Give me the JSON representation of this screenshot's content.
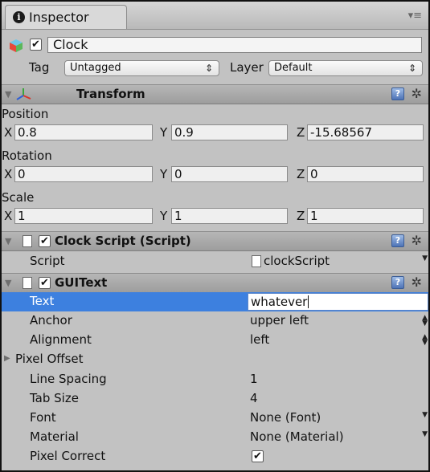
{
  "window": {
    "tab_label": "Inspector",
    "tab_icon": "info-icon",
    "menu_icon": "tab-menu-icon"
  },
  "game_object": {
    "active": true,
    "name": "Clock",
    "tag_label": "Tag",
    "tag_value": "Untagged",
    "layer_label": "Layer",
    "layer_value": "Default",
    "icon": "gameobject-cube-icon"
  },
  "transform": {
    "title": "Transform",
    "icon": "transform-axes-icon",
    "position_label": "Position",
    "position": {
      "x": "0.8",
      "y": "0.9",
      "z": "-15.68567"
    },
    "rotation_label": "Rotation",
    "rotation": {
      "x": "0",
      "y": "0",
      "z": "0"
    },
    "scale_label": "Scale",
    "scale": {
      "x": "1",
      "y": "1",
      "z": "1"
    },
    "axis_labels": {
      "x": "X",
      "y": "Y",
      "z": "Z"
    }
  },
  "clock_script": {
    "title": "Clock Script (Script)",
    "enabled": true,
    "script_label": "Script",
    "script_value": "clockScript"
  },
  "gui_text": {
    "title": "GUIText",
    "enabled": true,
    "properties": [
      {
        "label": "Text",
        "value": "whatever"
      },
      {
        "label": "Anchor",
        "value": "upper left"
      },
      {
        "label": "Alignment",
        "value": "left"
      },
      {
        "label": "Pixel Offset",
        "value": ""
      },
      {
        "label": "Line Spacing",
        "value": "1"
      },
      {
        "label": "Tab Size",
        "value": "4"
      },
      {
        "label": "Font",
        "value": "None (Font)"
      },
      {
        "label": "Material",
        "value": "None (Material)"
      },
      {
        "label": "Pixel Correct",
        "value": ""
      }
    ],
    "pixel_correct": true
  },
  "colors": {
    "panel_bg": "#c2c2c2",
    "selection": "#3d80df",
    "help_icon": "#4d73b6"
  },
  "glyphs": {
    "check": "✔",
    "fold_open": "▼",
    "fold_closed": "▶",
    "dropdown_arrow": "⇕",
    "gear": "✲",
    "help": "?",
    "menu": "▾≡"
  }
}
